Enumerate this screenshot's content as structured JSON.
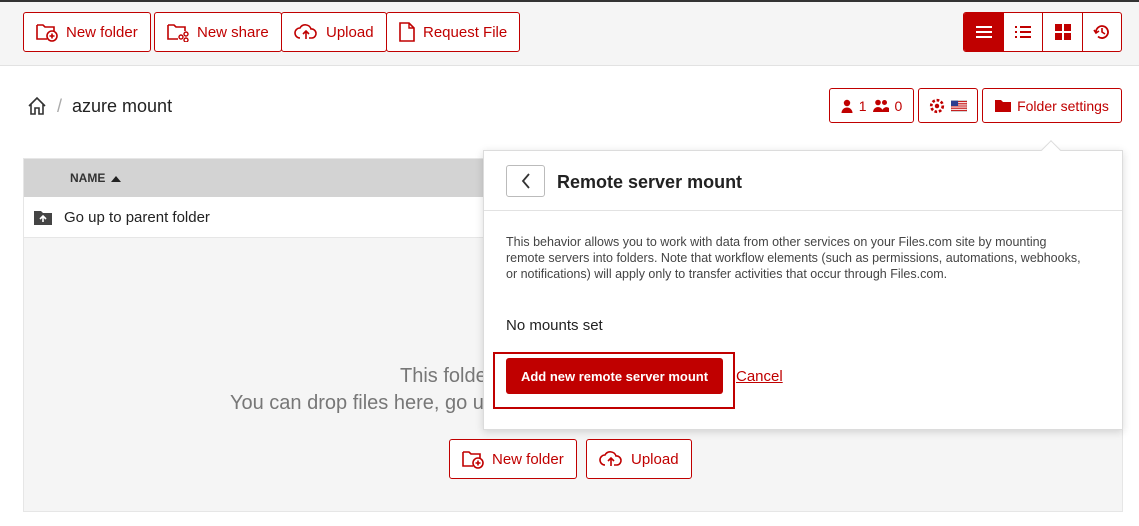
{
  "toolbar": {
    "new_folder": "New folder",
    "new_share": "New share",
    "upload": "Upload",
    "request_file": "Request File"
  },
  "view_modes": [
    "list-view-icon",
    "detail-list-icon",
    "grid-view-icon",
    "history-icon"
  ],
  "breadcrumb": {
    "separator": "/",
    "current": "azure mount"
  },
  "folder_bar": {
    "user_count": "1",
    "group_count": "0",
    "folder_settings": "Folder settings"
  },
  "file_list": {
    "name_header": "NAME",
    "parent_row": "Go up to parent folder",
    "empty_line1": "This folde",
    "empty_line2": "You can drop files here, go u",
    "new_folder": "New folder",
    "upload": "Upload"
  },
  "popup": {
    "title": "Remote server mount",
    "description": "This behavior allows you to work with data from other services on your Files.com site by mounting remote servers into folders. Note that workflow elements (such as permissions, automations, webhooks, or notifications) will apply only to transfer activities that occur through Files.com.",
    "no_mounts": "No mounts set",
    "add_button": "Add new remote server mount",
    "cancel": "Cancel"
  },
  "colors": {
    "accent": "#c00000",
    "panel_bg": "#f5f5f5",
    "header_bg": "#d3d3d3"
  }
}
